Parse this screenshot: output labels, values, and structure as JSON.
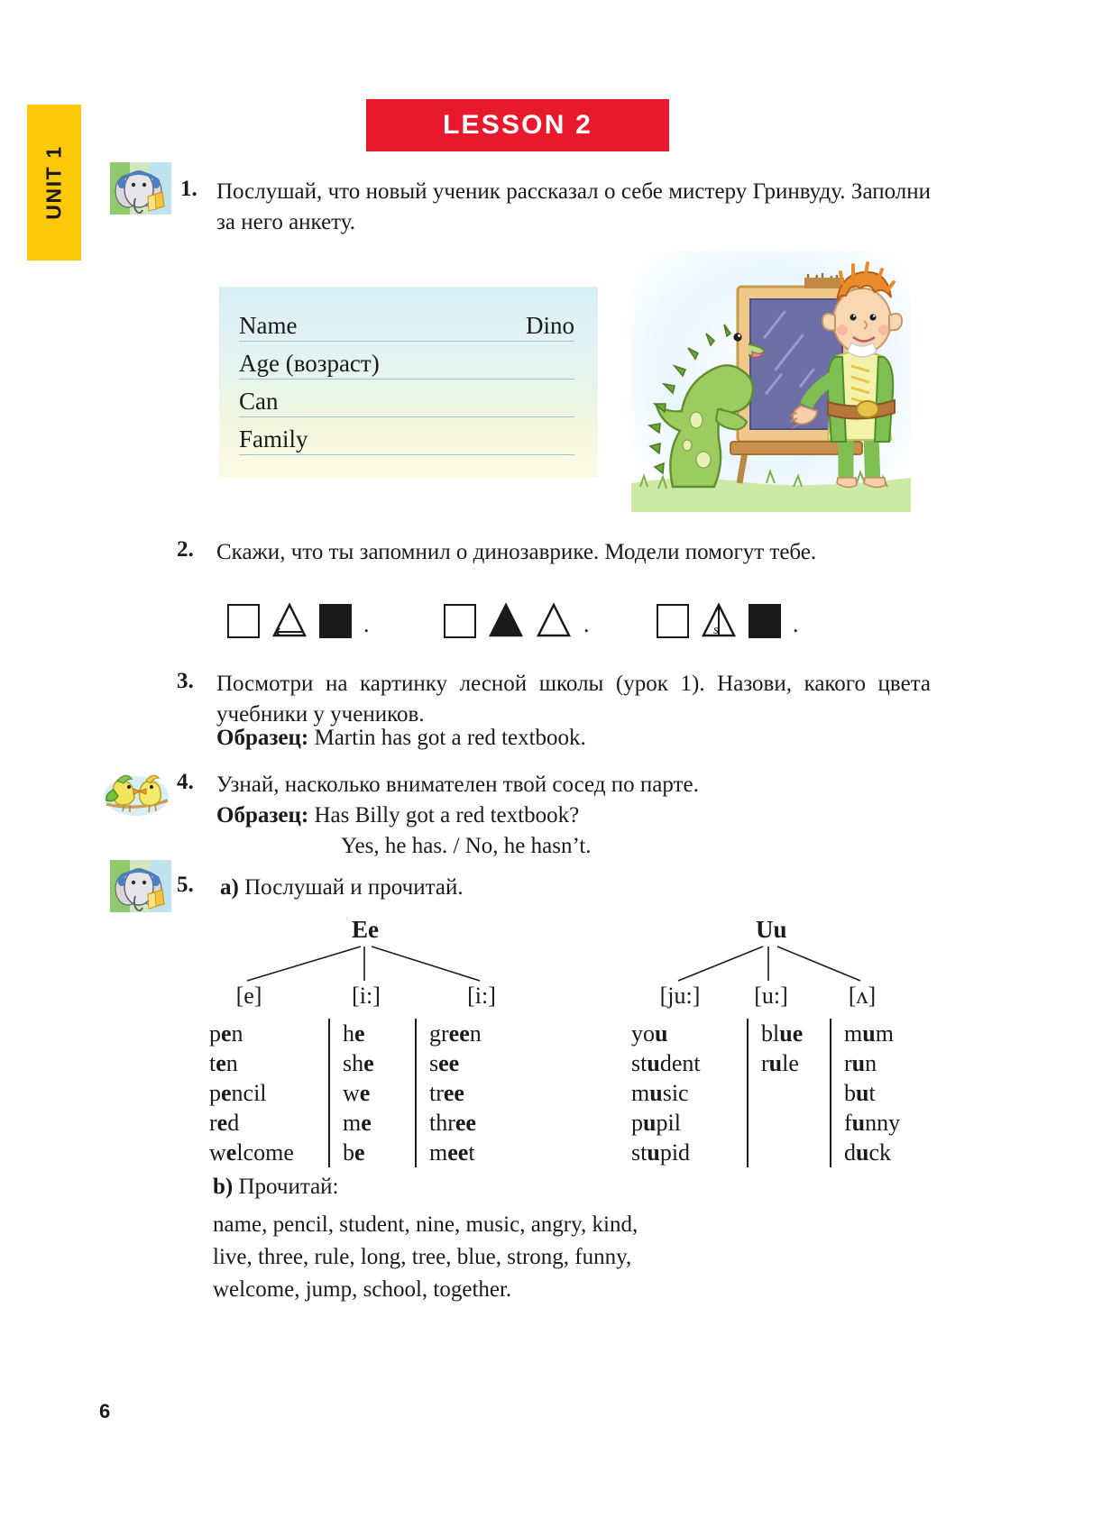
{
  "unit": {
    "label": "UNIT 1"
  },
  "lesson": {
    "label": "LESSON 2"
  },
  "page": {
    "number": "6"
  },
  "exercises": {
    "e1": {
      "number": "1.",
      "text": "Послушай, что новый ученик рассказал о себе мистеру Гринвуду. Заполни за него анкету.",
      "icon": "elephant-headphones-icon"
    },
    "e2": {
      "number": "2.",
      "text": "Скажи, что ты запомнил о динозаврике. Модели помогут тебе."
    },
    "e3": {
      "number": "3.",
      "text": "Посмотри на картинку лесной школы (урок 1). Назови, какого цвета учебники у учеников.",
      "example_label": "Образец:",
      "example_text": "Martin has got a red textbook."
    },
    "e4": {
      "number": "4.",
      "text": "Узнай, насколько внимателен твой сосед по парте.",
      "example_label": "Образец:",
      "example_line1": "Has Billy got a red textbook?",
      "example_line2": "Yes, he has. / No, he hasn’t.",
      "icon": "two-birds-icon"
    },
    "e5": {
      "number": "5.",
      "part_a_label": "a)",
      "part_a_text": "Послушай и прочитай.",
      "part_b_label": "b)",
      "part_b_text": "Прочитай:",
      "icon": "elephant-headphones-icon",
      "read_list_line1": "name, pencil, student, nine, music, angry, kind,",
      "read_list_line2": "live, three, rule, long, tree, blue, strong, funny,",
      "read_list_line3": "welcome, jump, school, together."
    }
  },
  "form_card": {
    "rows": [
      {
        "label": "Name",
        "value": "Dino"
      },
      {
        "label": "Age  (возраст)",
        "value": ""
      },
      {
        "label": "Can",
        "value": ""
      },
      {
        "label": "Family",
        "value": ""
      }
    ]
  },
  "models": {
    "groups": [
      {
        "shapes": [
          "square-outline",
          "triangle-outline",
          "square-filled"
        ],
        "punct": "."
      },
      {
        "shapes": [
          "square-outline",
          "triangle-filled",
          "triangle-outline"
        ],
        "punct": "."
      },
      {
        "shapes": [
          "square-outline",
          "triangle-s-outline",
          "square-filled"
        ],
        "punct": "."
      }
    ]
  },
  "phonics": {
    "trees": [
      {
        "letter": "Ee",
        "sounds": [
          "[e]",
          "[i:]",
          "[i:]"
        ],
        "columns": [
          {
            "words": [
              {
                "pre": "p",
                "bold": "e",
                "post": "n"
              },
              {
                "pre": "t",
                "bold": "e",
                "post": "n"
              },
              {
                "pre": "p",
                "bold": "e",
                "post": "ncil"
              },
              {
                "pre": "r",
                "bold": "e",
                "post": "d"
              },
              {
                "pre": "w",
                "bold": "e",
                "post": "lcome"
              }
            ]
          },
          {
            "words": [
              {
                "pre": "h",
                "bold": "e",
                "post": ""
              },
              {
                "pre": "sh",
                "bold": "e",
                "post": ""
              },
              {
                "pre": "w",
                "bold": "e",
                "post": ""
              },
              {
                "pre": "m",
                "bold": "e",
                "post": ""
              },
              {
                "pre": "b",
                "bold": "e",
                "post": ""
              }
            ]
          },
          {
            "words": [
              {
                "pre": "gr",
                "bold": "ee",
                "post": "n"
              },
              {
                "pre": "s",
                "bold": "ee",
                "post": ""
              },
              {
                "pre": "tr",
                "bold": "ee",
                "post": ""
              },
              {
                "pre": "thr",
                "bold": "ee",
                "post": ""
              },
              {
                "pre": "m",
                "bold": "ee",
                "post": "t"
              }
            ]
          }
        ]
      },
      {
        "letter": "Uu",
        "sounds": [
          "[ju:]",
          "[u:]",
          "[ʌ]"
        ],
        "columns": [
          {
            "words": [
              {
                "pre": "yo",
                "bold": "u",
                "post": ""
              },
              {
                "pre": "st",
                "bold": "u",
                "post": "dent"
              },
              {
                "pre": "m",
                "bold": "u",
                "post": "sic"
              },
              {
                "pre": "p",
                "bold": "u",
                "post": "pil"
              },
              {
                "pre": "st",
                "bold": "u",
                "post": "pid"
              }
            ]
          },
          {
            "words": [
              {
                "pre": "bl",
                "bold": "ue",
                "post": ""
              },
              {
                "pre": "r",
                "bold": "u",
                "post": "le"
              }
            ]
          },
          {
            "words": [
              {
                "pre": "m",
                "bold": "u",
                "post": "m"
              },
              {
                "pre": "r",
                "bold": "u",
                "post": "n"
              },
              {
                "pre": "b",
                "bold": "u",
                "post": "t"
              },
              {
                "pre": "f",
                "bold": "u",
                "post": "nny"
              },
              {
                "pre": "d",
                "bold": "u",
                "post": "ck"
              }
            ]
          }
        ]
      }
    ]
  },
  "colors": {
    "unit_tab": "#fcc80a",
    "lesson_banner": "#e8192c",
    "form_rule": "#9ec3d6"
  }
}
